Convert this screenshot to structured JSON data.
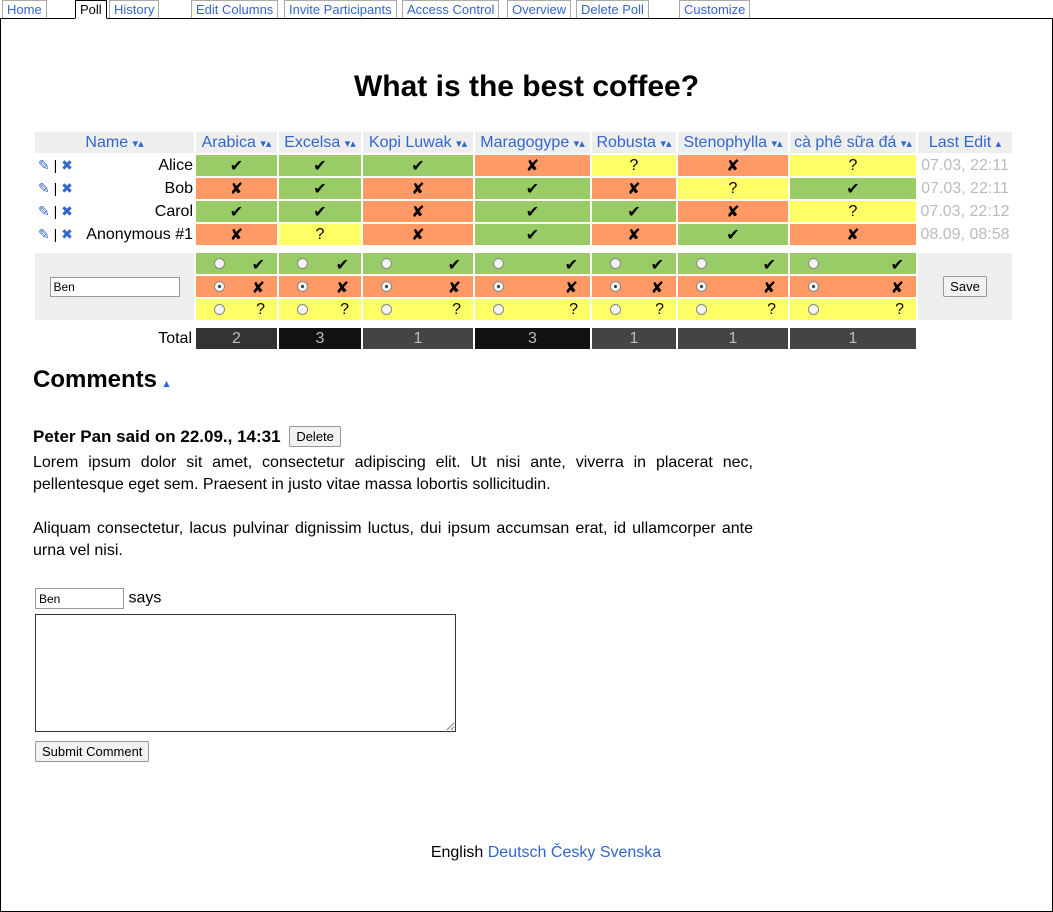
{
  "tabs": [
    {
      "label": "Home",
      "active": false
    },
    {
      "label": "Poll",
      "active": true
    },
    {
      "label": "History",
      "active": false
    },
    {
      "label": "Edit Columns",
      "active": false
    },
    {
      "label": "Invite Participants",
      "active": false
    },
    {
      "label": "Access Control",
      "active": false
    },
    {
      "label": "Overview",
      "active": false
    },
    {
      "label": "Delete Poll",
      "active": false
    },
    {
      "label": "Customize",
      "active": false
    }
  ],
  "poll": {
    "title": "What is the best coffee?",
    "name_header": "Name",
    "last_edit_header": "Last Edit",
    "sort_both": "▾▴",
    "sort_up": "▴",
    "columns": [
      "Arabica",
      "Excelsa",
      "Kopi Luwak",
      "Maragogype",
      "Robusta",
      "Stenophylla",
      "cà phê sữa đá"
    ],
    "icons": {
      "edit": "pencil-icon",
      "delete": "delete-x-icon"
    },
    "edit_glyph": "✎",
    "sep": "|",
    "delete_glyph": "✖",
    "participants": [
      {
        "name": "Alice",
        "last_edit": "07.03, 22:11",
        "votes": [
          "yes",
          "yes",
          "yes",
          "no",
          "maybe",
          "no",
          "maybe"
        ]
      },
      {
        "name": "Bob",
        "last_edit": "07.03, 22:11",
        "votes": [
          "no",
          "yes",
          "no",
          "yes",
          "no",
          "maybe",
          "yes"
        ]
      },
      {
        "name": "Carol",
        "last_edit": "07.03, 22:12",
        "votes": [
          "yes",
          "yes",
          "no",
          "yes",
          "yes",
          "no",
          "maybe"
        ]
      },
      {
        "name": "Anonymous #1",
        "last_edit": "08.09, 08:58",
        "votes": [
          "no",
          "maybe",
          "no",
          "yes",
          "no",
          "yes",
          "no"
        ]
      }
    ],
    "symbols": {
      "yes": "✔",
      "no": "✘",
      "maybe": "?"
    },
    "new_entry": {
      "name_value": "Ben",
      "selected": "no",
      "save_label": "Save"
    },
    "total_label": "Total",
    "totals": [
      2,
      3,
      1,
      3,
      1,
      1,
      1
    ],
    "total_colors": {
      "1": "#444444",
      "2": "#333333",
      "3": "#111111"
    }
  },
  "colors": {
    "yes": "#99cc66",
    "no": "#ff9966",
    "maybe": "#ffff66",
    "link": "#3366cc"
  },
  "comments": {
    "heading": "Comments",
    "sort_arrow": "▴",
    "items": [
      {
        "author_line": "Peter Pan said on 22.09., 14:31",
        "delete_label": "Delete",
        "paragraphs": [
          "Lorem ipsum dolor sit amet, consectetur adipiscing elit. Ut nisi ante, viverra in placerat nec, pellentesque eget sem. Praesent in justo vitae massa lobortis sollicitudin.",
          "Aliquam consectetur, lacus pulvinar dignissim luctus, dui ipsum accumsan erat, id ullamcorper ante urna vel nisi."
        ]
      }
    ],
    "form": {
      "name_value": "Ben",
      "says": "says",
      "submit_label": "Submit Comment"
    }
  },
  "languages": {
    "current": "English",
    "others": [
      "Deutsch",
      "Česky",
      "Svenska"
    ]
  }
}
